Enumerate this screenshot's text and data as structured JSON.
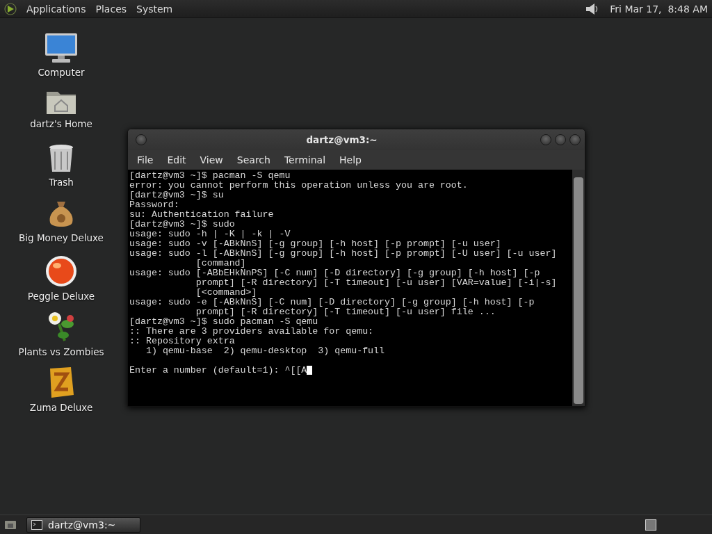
{
  "top_panel": {
    "menus": [
      "Applications",
      "Places",
      "System"
    ],
    "clock": "Fri Mar 17,  8:48 AM"
  },
  "desktop_icons": [
    {
      "kind": "computer",
      "label": "Computer"
    },
    {
      "kind": "home",
      "label": "dartz's Home"
    },
    {
      "kind": "trash",
      "label": "Trash"
    },
    {
      "kind": "money",
      "label": "Big Money Deluxe"
    },
    {
      "kind": "ball",
      "label": "Peggle Deluxe"
    },
    {
      "kind": "plant",
      "label": "Plants vs Zombies"
    },
    {
      "kind": "block",
      "label": "Zuma Deluxe"
    }
  ],
  "window": {
    "title": "dartz@vm3:~",
    "menu": [
      "File",
      "Edit",
      "View",
      "Search",
      "Terminal",
      "Help"
    ],
    "lines": [
      {
        "text": "[dartz@vm3 ~]$ pacman -S qemu"
      },
      {
        "text": "error: you cannot perform this operation unless you are root."
      },
      {
        "text": "[dartz@vm3 ~]$ su"
      },
      {
        "text": "Password:"
      },
      {
        "text": "su: Authentication failure"
      },
      {
        "text": "[dartz@vm3 ~]$ sudo"
      },
      {
        "text": "usage: sudo -h | -K | -k | -V"
      },
      {
        "text": "usage: sudo -v [-ABkNnS] [-g group] [-h host] [-p prompt] [-u user]"
      },
      {
        "text": "usage: sudo -l [-ABkNnS] [-g group] [-h host] [-p prompt] [-U user] [-u user]"
      },
      {
        "text": "            [command]"
      },
      {
        "text": "usage: sudo [-ABbEHkNnPS] [-C num] [-D directory] [-g group] [-h host] [-p"
      },
      {
        "text": "            prompt] [-R directory] [-T timeout] [-u user] [VAR=value] [-i|-s]"
      },
      {
        "text": "            [<command>]"
      },
      {
        "text": "usage: sudo -e [-ABkNnS] [-C num] [-D directory] [-g group] [-h host] [-p"
      },
      {
        "text": "            prompt] [-R directory] [-T timeout] [-u user] file ..."
      },
      {
        "text": "[dartz@vm3 ~]$ sudo pacman -S qemu"
      },
      {
        "text": ":: There are 3 providers available for qemu:"
      },
      {
        "text": ":: Repository extra"
      },
      {
        "text": "   1) qemu-base  2) qemu-desktop  3) qemu-full"
      },
      {
        "text": "Enter a number (default=1): ^[[A",
        "gap_before": true,
        "cursor": true
      }
    ]
  },
  "taskbar": {
    "tasks": [
      {
        "label": "dartz@vm3:~",
        "selected": true
      }
    ]
  }
}
